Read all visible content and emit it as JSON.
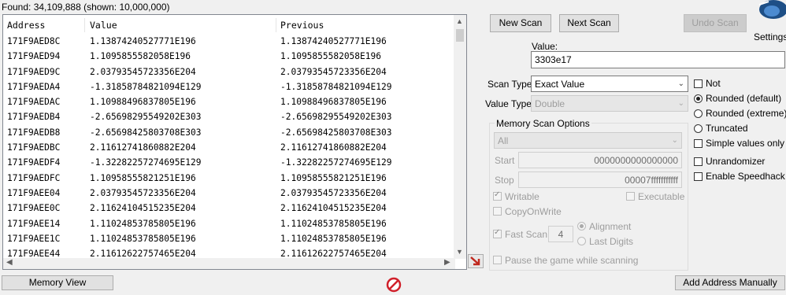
{
  "found_label": "Found: 34,109,888 (shown: 10,000,000)",
  "results": {
    "headers": {
      "address": "Address",
      "value": "Value",
      "previous": "Previous"
    },
    "rows": [
      {
        "address": "171F9AED8C",
        "value": "1.13874240527771E196",
        "previous": "1.13874240527771E196"
      },
      {
        "address": "171F9AED94",
        "value": "1.1095855582058E196",
        "previous": "1.1095855582058E196"
      },
      {
        "address": "171F9AED9C",
        "value": "2.03793545723356E204",
        "previous": "2.03793545723356E204"
      },
      {
        "address": "171F9AEDA4",
        "value": "-1.31858784821094E129",
        "previous": "-1.31858784821094E129"
      },
      {
        "address": "171F9AEDAC",
        "value": "1.10988496837805E196",
        "previous": "1.10988496837805E196"
      },
      {
        "address": "171F9AEDB4",
        "value": "-2.65698295549202E303",
        "previous": "-2.65698295549202E303"
      },
      {
        "address": "171F9AEDB8",
        "value": "-2.65698425803708E303",
        "previous": "-2.65698425803708E303"
      },
      {
        "address": "171F9AEDBC",
        "value": "2.11612741860882E204",
        "previous": "2.11612741860882E204"
      },
      {
        "address": "171F9AEDF4",
        "value": "-1.32282257274695E129",
        "previous": "-1.32282257274695E129"
      },
      {
        "address": "171F9AEDFC",
        "value": "1.10958555821251E196",
        "previous": "1.10958555821251E196"
      },
      {
        "address": "171F9AEE04",
        "value": "2.03793545723356E204",
        "previous": "2.03793545723356E204"
      },
      {
        "address": "171F9AEE0C",
        "value": "2.11624104515235E204",
        "previous": "2.11624104515235E204"
      },
      {
        "address": "171F9AEE14",
        "value": "1.11024853785805E196",
        "previous": "1.11024853785805E196"
      },
      {
        "address": "171F9AEE1C",
        "value": "1.11024853785805E196",
        "previous": "1.11024853785805E196"
      },
      {
        "address": "171F9AEE44",
        "value": "2.11612622757465E204",
        "previous": "2.11612622757465E204"
      }
    ]
  },
  "buttons": {
    "new_scan": "New Scan",
    "next_scan": "Next Scan",
    "undo_scan": "Undo Scan",
    "memory_view": "Memory View",
    "add_address": "Add Address Manually"
  },
  "settings_label": "Settings",
  "value_label": "Value:",
  "value_input": "3303e17",
  "scan_type": {
    "label": "Scan Type",
    "selected": "Exact Value"
  },
  "value_type": {
    "label": "Value Type",
    "selected": "Double"
  },
  "memory_scan_options": {
    "title": "Memory Scan Options",
    "region": "All",
    "start_label": "Start",
    "start_value": "0000000000000000",
    "stop_label": "Stop",
    "stop_value": "00007fffffffffff",
    "writable": "Writable",
    "executable": "Executable",
    "copy_on_write": "CopyOnWrite",
    "fast_scan": "Fast Scan",
    "fast_scan_value": "4",
    "alignment": "Alignment",
    "last_digits": "Last Digits",
    "pause_game": "Pause the game while scanning"
  },
  "options": {
    "not": "Not",
    "rounded_default": "Rounded (default)",
    "rounded_extreme": "Rounded (extreme)",
    "truncated": "Truncated",
    "simple_values_only": "Simple values only",
    "unrandomizer": "Unrandomizer",
    "enable_speedhack": "Enable Speedhack"
  },
  "colors": {
    "stop_icon": "#d0202a",
    "arrow_icon": "#c0281e"
  }
}
